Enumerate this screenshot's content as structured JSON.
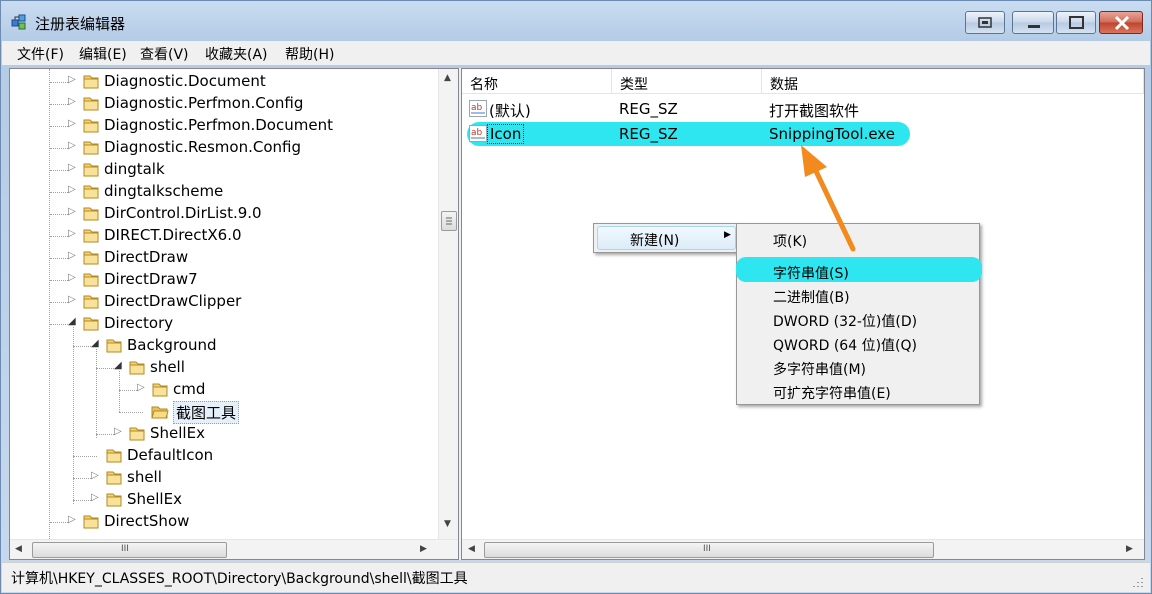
{
  "window": {
    "title": "注册表编辑器",
    "colors": {
      "highlight": "#2EE6EF",
      "arrow": "#F28A1E",
      "titlebar": "#C9DCF1",
      "close": "#C0432C"
    }
  },
  "menubar": {
    "items": [
      "文件(F)",
      "编辑(E)",
      "查看(V)",
      "收藏夹(A)",
      "帮助(H)"
    ]
  },
  "tree": {
    "items": [
      {
        "label": "Diagnostic.Document",
        "icon": "folder-icon",
        "expander": "collapsed"
      },
      {
        "label": "Diagnostic.Perfmon.Config",
        "icon": "folder-icon",
        "expander": "collapsed"
      },
      {
        "label": "Diagnostic.Perfmon.Document",
        "icon": "folder-icon",
        "expander": "collapsed"
      },
      {
        "label": "Diagnostic.Resmon.Config",
        "icon": "folder-icon",
        "expander": "collapsed"
      },
      {
        "label": "dingtalk",
        "icon": "folder-icon",
        "expander": "collapsed"
      },
      {
        "label": "dingtalkscheme",
        "icon": "folder-icon",
        "expander": "collapsed"
      },
      {
        "label": "DirControl.DirList.9.0",
        "icon": "folder-icon",
        "expander": "collapsed"
      },
      {
        "label": "DIRECT.DirectX6.0",
        "icon": "folder-icon",
        "expander": "collapsed"
      },
      {
        "label": "DirectDraw",
        "icon": "folder-icon",
        "expander": "collapsed"
      },
      {
        "label": "DirectDraw7",
        "icon": "folder-icon",
        "expander": "collapsed"
      },
      {
        "label": "DirectDrawClipper",
        "icon": "folder-icon",
        "expander": "collapsed"
      },
      {
        "label": "Directory",
        "icon": "folder-icon",
        "expander": "expanded"
      },
      {
        "label": "Background",
        "icon": "folder-icon",
        "expander": "expanded"
      },
      {
        "label": "shell",
        "icon": "folder-icon",
        "expander": "expanded"
      },
      {
        "label": "cmd",
        "icon": "folder-icon",
        "expander": "collapsed"
      },
      {
        "label": "截图工具",
        "icon": "folder-open-icon",
        "expander": "none",
        "selected": true
      },
      {
        "label": "ShellEx",
        "icon": "folder-icon",
        "expander": "collapsed"
      },
      {
        "label": "DefaultIcon",
        "icon": "folder-icon",
        "expander": "none"
      },
      {
        "label": "shell",
        "icon": "folder-icon",
        "expander": "collapsed"
      },
      {
        "label": "ShellEx",
        "icon": "folder-icon",
        "expander": "collapsed"
      },
      {
        "label": "DirectShow",
        "icon": "folder-icon",
        "expander": "collapsed"
      }
    ],
    "hscroll_grip": "III"
  },
  "list": {
    "columns": [
      "名称",
      "类型",
      "数据"
    ],
    "rows": [
      {
        "name": "(默认)",
        "type": "REG_SZ",
        "data": "打开截图软件",
        "icon": "reg-string-icon"
      },
      {
        "name": "Icon",
        "type": "REG_SZ",
        "data": "SnippingTool.exe",
        "icon": "reg-string-icon",
        "highlighted": true
      }
    ],
    "hscroll_grip": "III"
  },
  "context_menu": {
    "new_label": "新建(N)",
    "submenu": [
      "项(K)",
      "字符串值(S)",
      "二进制值(B)",
      "DWORD (32-位)值(D)",
      "QWORD (64 位)值(Q)",
      "多字符串值(M)",
      "可扩充字符串值(E)"
    ],
    "highlighted_item": "字符串值(S)"
  },
  "status": {
    "path": "计算机\\HKEY_CLASSES_ROOT\\Directory\\Background\\shell\\截图工具"
  }
}
